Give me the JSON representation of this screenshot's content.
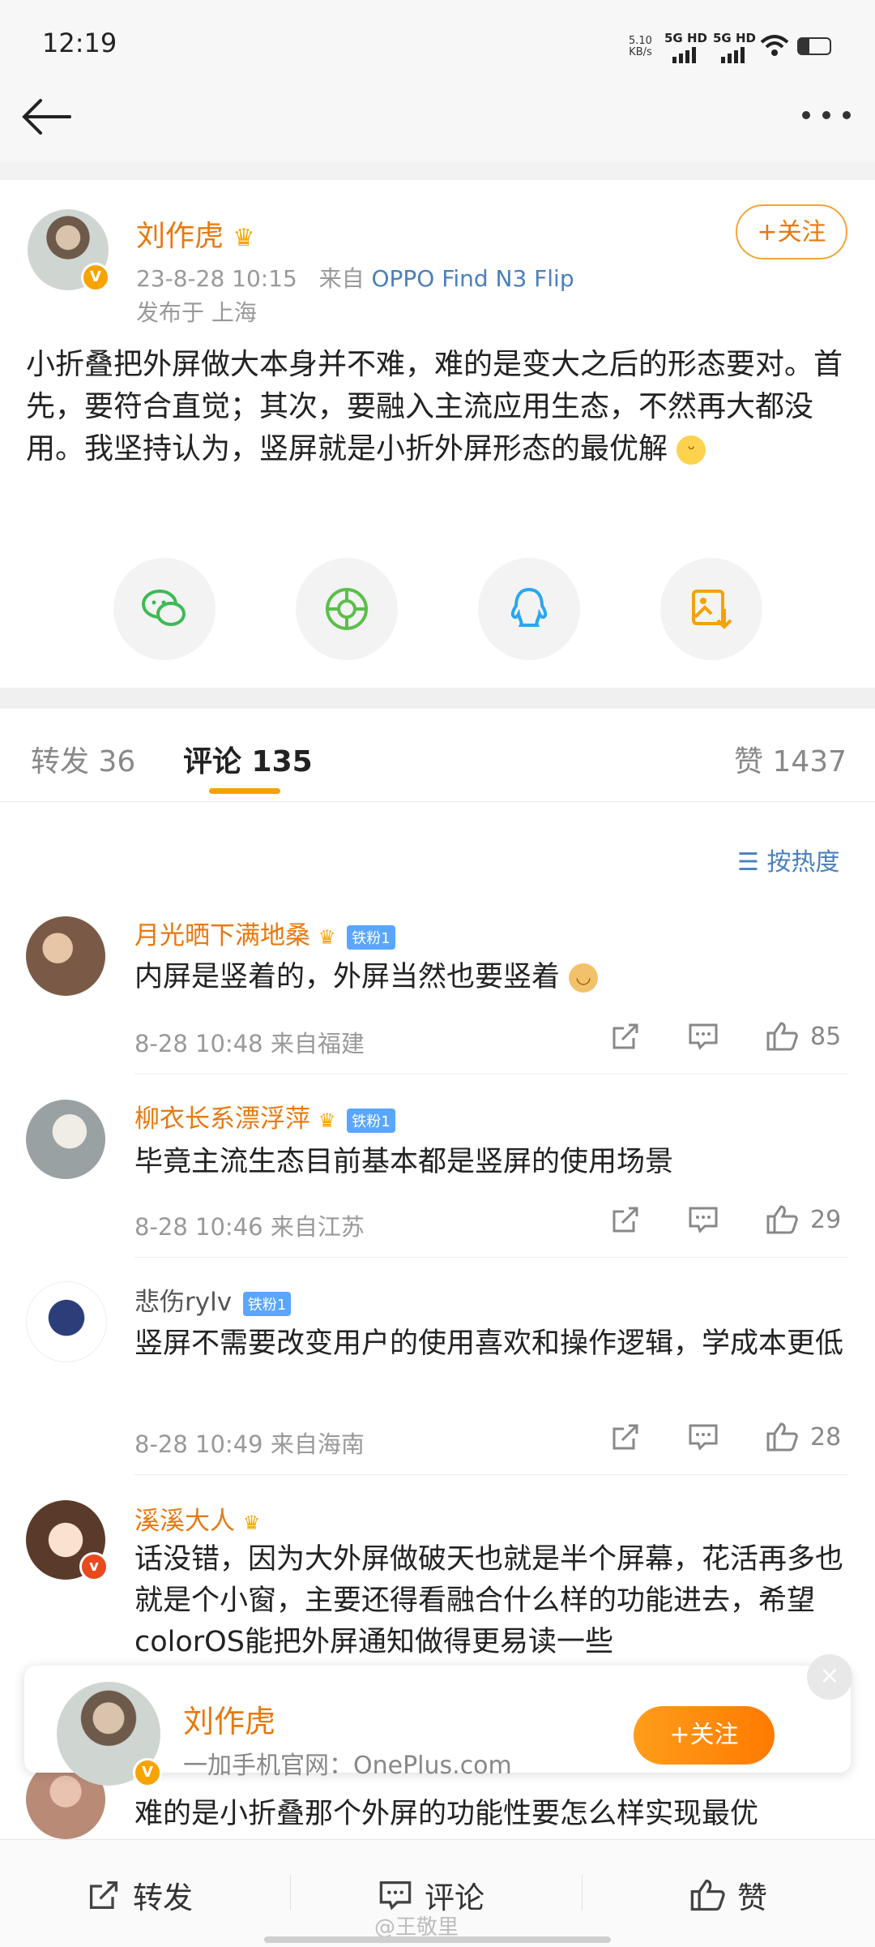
{
  "status_bar": {
    "time": "12:19",
    "speed_value": "5.10",
    "speed_unit": "KB/s",
    "sim1": "5G HD",
    "sim2": "5G HD",
    "battery_level": 0.35
  },
  "nav": {
    "back_icon": "arrow-left-icon",
    "more_icon": "more-dots-icon"
  },
  "post": {
    "author": "刘作虎",
    "timestamp": "23-8-28 10:15",
    "source_prefix": "来自",
    "source": "OPPO Find N3 Flip",
    "location": "发布于 上海",
    "follow_label": "+关注",
    "text": "小折叠把外屏做大本身并不难，难的是变大之后的形态要对。首先，要符合直觉；其次，要融入主流应用生态，不然再大都没用。我坚持认为，竖屏就是小折外屏形态的最优解",
    "verified_mark": "V"
  },
  "share_icons": [
    "wechat-icon",
    "moments-icon",
    "qq-icon",
    "save-image-icon"
  ],
  "tabs": {
    "repost": "转发 36",
    "comments": "评论 135",
    "likes": "赞 1437"
  },
  "sort_label": "按热度",
  "comments": [
    {
      "name": "月光晒下满地桑",
      "badge": "铁粉1",
      "text": "内屏是竖着的，外屏当然也要竖着",
      "time": "8-28 10:48 来自福建",
      "likes": "85"
    },
    {
      "name": "柳衣长系漂浮萍",
      "badge": "铁粉1",
      "text": "毕竟主流生态目前基本都是竖屏的使用场景",
      "time": "8-28 10:46 来自江苏",
      "likes": "29"
    },
    {
      "name": "悲伤rylv",
      "badge": "铁粉1",
      "text": "竖屏不需要改变用户的使用喜欢和操作逻辑，学成本更低",
      "time": "8-28 10:49 来自海南",
      "likes": "28"
    },
    {
      "name": "溪溪大人",
      "badge": "",
      "text": "话没错，因为大外屏做破天也就是半个屏幕，花活再多也就是个小窗，主要还得看融合什么样的功能进去，希望colorOS能把外屏通知做得更易读一些",
      "time": "",
      "likes": ""
    },
    {
      "name": "",
      "badge": "",
      "text": "难的是小折叠那个外屏的功能性要怎么样实现最优",
      "time": "",
      "likes": ""
    }
  ],
  "float_card": {
    "name": "刘作虎",
    "subtitle": "一加手机官网：OnePlus.com",
    "follow_label": "+关注",
    "close_label": "×"
  },
  "bottom_bar": {
    "repost": "转发",
    "comment": "评论",
    "like": "赞"
  },
  "watermark": "@王敬里",
  "colors": {
    "accent": "#e8780d",
    "link": "#4b7fbd",
    "tab_underline": "#f5a200"
  }
}
